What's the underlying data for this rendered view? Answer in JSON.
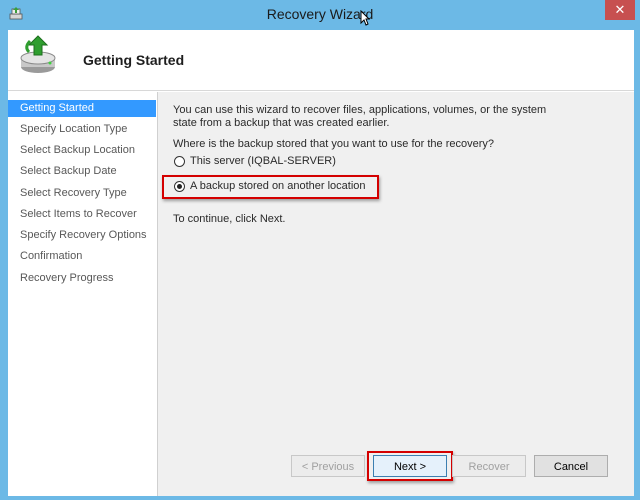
{
  "window": {
    "title": "Recovery Wizard",
    "close_glyph": "✕"
  },
  "header": {
    "title": "Getting Started",
    "icon": "backup-restore-icon"
  },
  "sidebar": {
    "items": [
      {
        "label": "Getting Started",
        "active": true
      },
      {
        "label": "Specify Location Type"
      },
      {
        "label": "Select Backup Location"
      },
      {
        "label": "Select Backup Date"
      },
      {
        "label": "Select Recovery Type"
      },
      {
        "label": "Select Items to Recover"
      },
      {
        "label": "Specify Recovery Options"
      },
      {
        "label": "Confirmation"
      },
      {
        "label": "Recovery Progress"
      }
    ]
  },
  "main": {
    "intro_line1": "You can use this wizard to recover files, applications, volumes, or the system",
    "intro_line2": "state from a backup that was created earlier.",
    "question": "Where is the backup stored that you want to use for the recovery?",
    "option_this_server": "This server (IQBAL-SERVER)",
    "option_other_location": "A backup stored on another location",
    "selected_option": "option_other_location",
    "continue_text": "To continue, click Next."
  },
  "buttons": {
    "previous": "< Previous",
    "next": "Next >",
    "recover": "Recover",
    "cancel": "Cancel"
  },
  "colors": {
    "title_bar": "#6cb9e6",
    "sidebar_active": "#3399ff",
    "highlight_box": "#d40000",
    "close_button": "#c75050"
  }
}
